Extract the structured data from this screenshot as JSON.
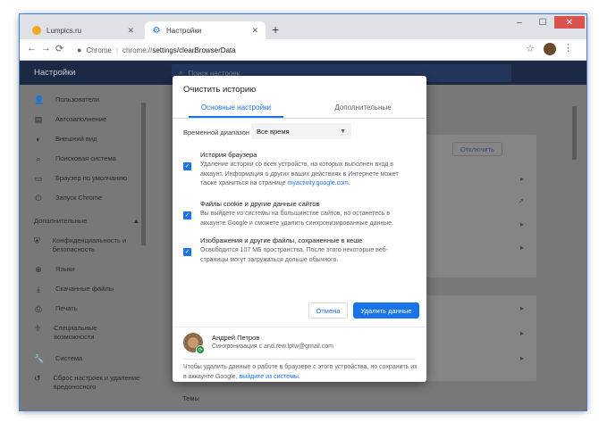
{
  "tabs": [
    {
      "title": "Lumpics.ru",
      "close": "✕"
    },
    {
      "title": "Настройки",
      "close": "✕"
    }
  ],
  "new_tab": "+",
  "window_controls": {
    "minimize": "–",
    "maximize": "☐",
    "close": "✕"
  },
  "address_bar": {
    "site_label": "Chrome",
    "separator": "|",
    "host": "chrome://",
    "path": "settings/clearBrowserData"
  },
  "nav": {
    "back": "←",
    "forward": "→",
    "reload": "⟳"
  },
  "toolbar_icons": {
    "star": "☆",
    "menu": "⋮"
  },
  "settings": {
    "title": "Настройки",
    "search_placeholder": "Поиск настроек"
  },
  "sidebar": {
    "items": [
      {
        "icon": "person-icon",
        "glyph": "👤",
        "label": "Пользователи"
      },
      {
        "icon": "clipboard-icon",
        "glyph": "▤",
        "label": "Автозаполнение"
      },
      {
        "icon": "palette-icon",
        "glyph": "◐",
        "label": "Внешний вид"
      },
      {
        "icon": "search-icon",
        "glyph": "⌕",
        "label": "Поисковая система"
      },
      {
        "icon": "browser-icon",
        "glyph": "▭",
        "label": "Браузер по умолчанию"
      },
      {
        "icon": "power-icon",
        "glyph": "⏻",
        "label": "Запуск Chrome"
      }
    ],
    "section": "Дополнительные",
    "section_caret": "▲",
    "advanced_items": [
      {
        "icon": "shield-icon",
        "glyph": "⛨",
        "label": "Конфиденциальность и безопасность"
      },
      {
        "icon": "globe-icon",
        "glyph": "⊕",
        "label": "Языки"
      },
      {
        "icon": "download-icon",
        "glyph": "⤓",
        "label": "Скачанные файлы"
      },
      {
        "icon": "print-icon",
        "glyph": "⎙",
        "label": "Печать"
      },
      {
        "icon": "accessibility-icon",
        "glyph": "☥",
        "label": "Специальные возможности"
      },
      {
        "icon": "wrench-icon",
        "glyph": "🔧",
        "label": "Система"
      },
      {
        "icon": "reset-icon",
        "glyph": "↺",
        "label": "Сброс настроек и удаление вредоносного"
      }
    ]
  },
  "main": {
    "disable_button": "Отключить",
    "themes_label": "Темы",
    "chevron": "▸",
    "external_icon": "↗"
  },
  "dialog": {
    "title": "Очистить историю",
    "tab_basic": "Основные настройки",
    "tab_advanced": "Дополнительные",
    "range_label": "Временной диапазон",
    "range_value": "Все время",
    "range_caret": "▼",
    "check_mark": "✓",
    "options": [
      {
        "title": "История браузера",
        "desc": "Удаление истории со всех устройств, на которых выполнен вход в аккаунт. Информация о других ваших действиях в Интернете может также храниться на странице ",
        "link": "myactivity.google.com",
        "suffix": ".",
        "checked": true
      },
      {
        "title": "Файлы cookie и другие данные сайтов",
        "desc": "Вы выйдете из системы на большинстве сайтов, но останетесь в аккаунте Google и сможете удалить синхронизированные данные.",
        "link": "",
        "suffix": "",
        "checked": true
      },
      {
        "title": "Изображения и другие файлы, сохраненные в кеше",
        "desc": "Освободится 107 МБ пространства. После этого некоторые веб-страницы могут загружаться дольше обычного.",
        "link": "",
        "suffix": "",
        "checked": true
      }
    ],
    "cancel_label": "Отмена",
    "clear_label": "Удалить данные",
    "user_name": "Андрей Петров",
    "sync_text": "Синхронизация с and.rew.lptw@gmail.com",
    "footer_text": "Чтобы удалить данные о работе в браузере с этого устройства, но сохранить их в аккаунте Google, ",
    "footer_link": "выйдите из системы",
    "footer_suffix": "."
  },
  "colors": {
    "accent": "#1a73e8",
    "header": "#1b2944",
    "overlay": "#787878"
  }
}
